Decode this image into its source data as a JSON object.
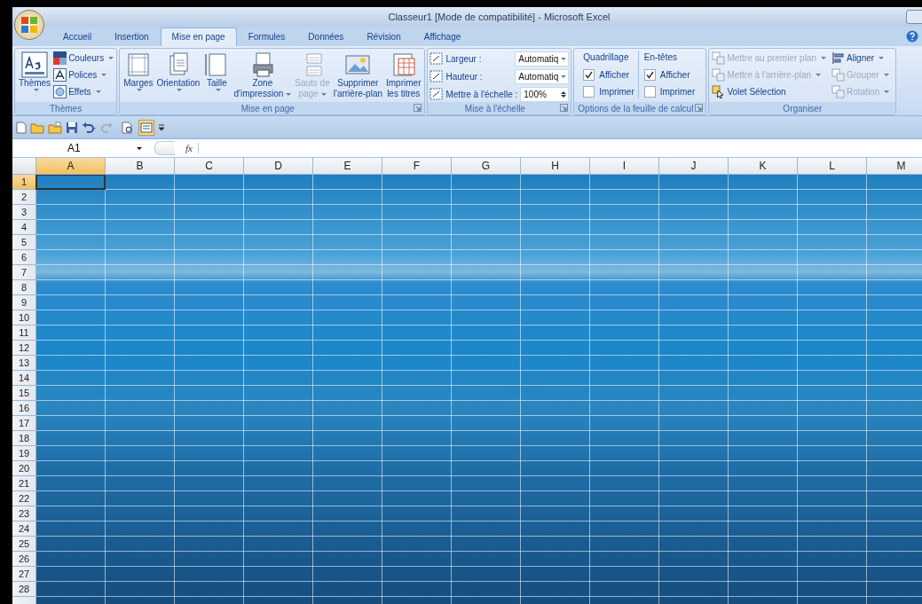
{
  "window": {
    "title": "Classeur1  [Mode de compatibilité] - Microsoft Excel"
  },
  "tabs": [
    {
      "label": "Accueil",
      "selected": false
    },
    {
      "label": "Insertion",
      "selected": false
    },
    {
      "label": "Mise en page",
      "selected": true
    },
    {
      "label": "Formules",
      "selected": false
    },
    {
      "label": "Données",
      "selected": false
    },
    {
      "label": "Révision",
      "selected": false
    },
    {
      "label": "Affichage",
      "selected": false
    }
  ],
  "ribbon": {
    "groups": [
      {
        "kind": "themes",
        "label": "Thèmes",
        "big": {
          "label": "Thèmes"
        },
        "items": [
          {
            "label": "Couleurs"
          },
          {
            "label": "Polices"
          },
          {
            "label": "Effets"
          }
        ]
      },
      {
        "kind": "large",
        "label": "Mise en page",
        "launcher": true,
        "buttons": [
          {
            "lines": [
              "Marges"
            ],
            "dropdown": true,
            "disabled": false
          },
          {
            "lines": [
              "Orientation"
            ],
            "dropdown": true,
            "disabled": false
          },
          {
            "lines": [
              "Taille"
            ],
            "dropdown": true,
            "disabled": false
          },
          {
            "lines": [
              "Zone",
              "d'impression"
            ],
            "dropdown": true,
            "disabled": false
          },
          {
            "lines": [
              "Sauts de",
              "page"
            ],
            "dropdown": true,
            "disabled": true
          },
          {
            "lines": [
              "Supprimer",
              "l'arrière-plan"
            ],
            "dropdown": false,
            "disabled": false
          },
          {
            "lines": [
              "Imprimer",
              "les titres"
            ],
            "dropdown": false,
            "disabled": false
          }
        ]
      },
      {
        "kind": "scale",
        "label": "Mise à l'échelle",
        "launcher": true,
        "rows": [
          {
            "label": "Largeur :",
            "value": "Automatiq",
            "kind": "dropdown"
          },
          {
            "label": "Hauteur :",
            "value": "Automatiq",
            "kind": "dropdown"
          },
          {
            "label": "Mettre à l'échelle :",
            "value": "100%",
            "kind": "spinner"
          }
        ]
      },
      {
        "kind": "sheet-options",
        "label": "Options de la feuille de calcul",
        "launcher": true,
        "columns": [
          {
            "heading": "Quadrillage",
            "options": [
              {
                "label": "Afficher",
                "checked": true
              },
              {
                "label": "Imprimer",
                "checked": false
              }
            ]
          },
          {
            "heading": "En-têtes",
            "options": [
              {
                "label": "Afficher",
                "checked": true
              },
              {
                "label": "Imprimer",
                "checked": false
              }
            ]
          }
        ]
      },
      {
        "kind": "arrange",
        "label": "Organiser",
        "items": [
          {
            "label": "Mettre au premier plan",
            "dropdown": true,
            "disabled": true
          },
          {
            "label": "Mettre à l'arrière-plan",
            "dropdown": true,
            "disabled": true
          },
          {
            "label": "Volet Sélection",
            "dropdown": false,
            "disabled": false
          },
          {
            "label": "Aligner",
            "dropdown": true,
            "disabled": false
          },
          {
            "label": "Grouper",
            "dropdown": true,
            "disabled": true
          },
          {
            "label": "Rotation",
            "dropdown": true,
            "disabled": true
          }
        ]
      }
    ]
  },
  "formula_bar": {
    "name_box": "A1",
    "fx": "fx"
  },
  "sheet": {
    "columns": [
      {
        "label": "A",
        "selected": true
      },
      {
        "label": "B",
        "selected": false
      },
      {
        "label": "C",
        "selected": false
      },
      {
        "label": "D",
        "selected": false
      },
      {
        "label": "E",
        "selected": false
      },
      {
        "label": "F",
        "selected": false
      },
      {
        "label": "G",
        "selected": false
      },
      {
        "label": "H",
        "selected": false
      },
      {
        "label": "I",
        "selected": false
      },
      {
        "label": "J",
        "selected": false
      },
      {
        "label": "K",
        "selected": false
      },
      {
        "label": "L",
        "selected": false
      },
      {
        "label": "M",
        "selected": false
      }
    ],
    "rows": [
      {
        "label": "1",
        "selected": true
      },
      {
        "label": "2",
        "selected": false
      },
      {
        "label": "3",
        "selected": false
      },
      {
        "label": "4",
        "selected": false
      },
      {
        "label": "5",
        "selected": false
      },
      {
        "label": "6",
        "selected": false
      },
      {
        "label": "7",
        "selected": false
      },
      {
        "label": "8",
        "selected": false
      },
      {
        "label": "9",
        "selected": false
      },
      {
        "label": "10",
        "selected": false
      },
      {
        "label": "11",
        "selected": false
      },
      {
        "label": "12",
        "selected": false
      },
      {
        "label": "13",
        "selected": false
      },
      {
        "label": "14",
        "selected": false
      },
      {
        "label": "15",
        "selected": false
      },
      {
        "label": "16",
        "selected": false
      },
      {
        "label": "17",
        "selected": false
      },
      {
        "label": "18",
        "selected": false
      },
      {
        "label": "19",
        "selected": false
      },
      {
        "label": "20",
        "selected": false
      },
      {
        "label": "21",
        "selected": false
      },
      {
        "label": "22",
        "selected": false
      },
      {
        "label": "23",
        "selected": false
      },
      {
        "label": "24",
        "selected": false
      },
      {
        "label": "25",
        "selected": false
      },
      {
        "label": "26",
        "selected": false
      },
      {
        "label": "27",
        "selected": false
      },
      {
        "label": "28",
        "selected": false
      }
    ]
  }
}
